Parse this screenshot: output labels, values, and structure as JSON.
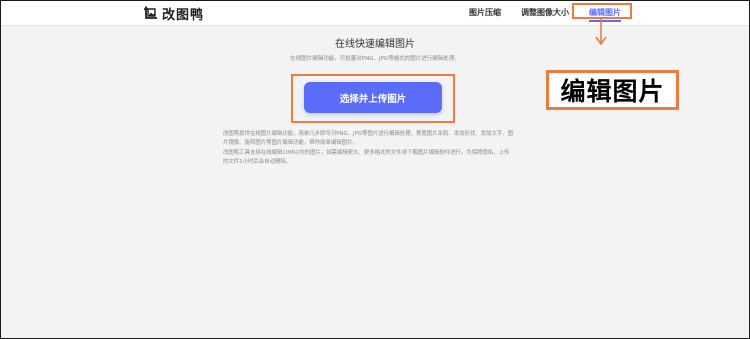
{
  "header": {
    "logo_text": "改图鸭",
    "nav": [
      {
        "label": "图片压缩"
      },
      {
        "label": "调整图像大小"
      },
      {
        "label": "编辑图片"
      }
    ]
  },
  "callout": {
    "text": "编辑图片"
  },
  "main": {
    "title": "在线快速编辑图片",
    "subtitle": "在线图片编辑功能，可批量对PNG、JPG等格式的图片进行编辑处理。",
    "upload_label": "选择并上传图片",
    "desc_lines": [
      "改图鸭提供在线图片编辑功能，简单几步即可对PNG、JPG等图片进行编辑处理，预置图片涂鸦、添加形状、添加文字、图",
      "片镜像、旋转图片等图片编辑功能，帮你简单编辑图片。",
      "改图鸭工具支持在线编辑10M以内的图片，如需编辑更大、更多格式的文件请下载图片编辑软件进行。为保障隐私，上传",
      "的文件1小时后会自动删除。"
    ]
  },
  "colors": {
    "accent": "#5b6cf8",
    "highlight": "#f07a3c"
  }
}
